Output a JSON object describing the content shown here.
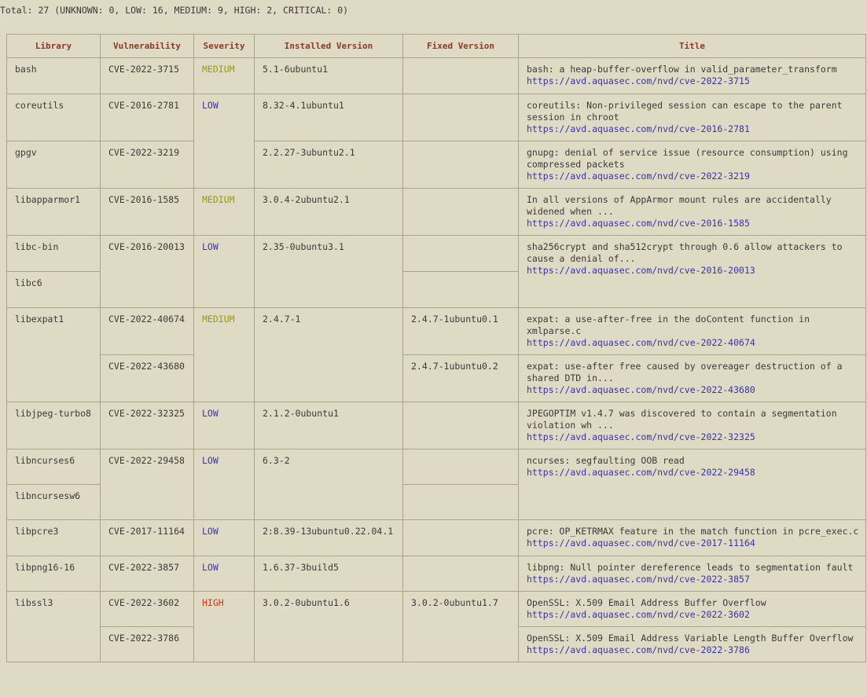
{
  "summary": "Total: 27 (UNKNOWN: 0, LOW: 16, MEDIUM: 9, HIGH: 2, CRITICAL: 0)",
  "columns": [
    "Library",
    "Vulnerability",
    "Severity",
    "Installed Version",
    "Fixed Version",
    "Title"
  ],
  "rows": [
    {
      "library": "bash",
      "vuln": "CVE-2022-3715",
      "severity": "MEDIUM",
      "installed": "5.1-6ubuntu1",
      "fixed": "",
      "title": "bash: a heap-buffer-overflow in valid_parameter_transform",
      "url": "https://avd.aquasec.com/nvd/cve-2022-3715"
    },
    {
      "library": "coreutils",
      "vuln": "CVE-2016-2781",
      "severity": "LOW",
      "installed": "8.32-4.1ubuntu1",
      "fixed": "",
      "title": "coreutils: Non-privileged session can escape to the parent session in chroot",
      "url": "https://avd.aquasec.com/nvd/cve-2016-2781"
    },
    {
      "library": "gpgv",
      "vuln": "CVE-2022-3219",
      "severity": "LOW",
      "installed": "2.2.27-3ubuntu2.1",
      "fixed": "",
      "title": "gnupg: denial of service issue (resource consumption) using compressed packets",
      "url": "https://avd.aquasec.com/nvd/cve-2022-3219"
    },
    {
      "library": "libapparmor1",
      "vuln": "CVE-2016-1585",
      "severity": "MEDIUM",
      "installed": "3.0.4-2ubuntu2.1",
      "fixed": "",
      "title": "In all versions of AppArmor mount rules are accidentally widened when ...",
      "url": "https://avd.aquasec.com/nvd/cve-2016-1585"
    },
    {
      "library": "libc-bin",
      "vuln": "CVE-2016-20013",
      "severity": "LOW",
      "installed": "2.35-0ubuntu3.1",
      "fixed": "",
      "title": "sha256crypt and sha512crypt through 0.6 allow attackers to cause a denial of...",
      "url": "https://avd.aquasec.com/nvd/cve-2016-20013"
    },
    {
      "library": "libc6",
      "vuln": "",
      "severity": "",
      "installed": "",
      "fixed": "",
      "title": "",
      "url": ""
    },
    {
      "library": "libexpat1",
      "vuln": "CVE-2022-40674",
      "severity": "MEDIUM",
      "installed": "2.4.7-1",
      "fixed": "2.4.7-1ubuntu0.1",
      "title": "expat: a use-after-free in the doContent function in xmlparse.c",
      "url": "https://avd.aquasec.com/nvd/cve-2022-40674"
    },
    {
      "library": "",
      "vuln": "CVE-2022-43680",
      "severity": "",
      "installed": "",
      "fixed": "2.4.7-1ubuntu0.2",
      "title": "expat: use-after free caused by overeager destruction of a shared DTD in...",
      "url": "https://avd.aquasec.com/nvd/cve-2022-43680"
    },
    {
      "library": "libjpeg-turbo8",
      "vuln": "CVE-2022-32325",
      "severity": "LOW",
      "installed": "2.1.2-0ubuntu1",
      "fixed": "",
      "title": "JPEGOPTIM v1.4.7 was discovered to contain a segmentation violation wh ...",
      "url": "https://avd.aquasec.com/nvd/cve-2022-32325"
    },
    {
      "library": "libncurses6",
      "vuln": "CVE-2022-29458",
      "severity": "LOW",
      "installed": "6.3-2",
      "fixed": "",
      "title": "ncurses: segfaulting OOB read",
      "url": "https://avd.aquasec.com/nvd/cve-2022-29458"
    },
    {
      "library": "libncursesw6",
      "vuln": "",
      "severity": "",
      "installed": "",
      "fixed": "",
      "title": "",
      "url": ""
    },
    {
      "library": "libpcre3",
      "vuln": "CVE-2017-11164",
      "severity": "LOW",
      "installed": "2:8.39-13ubuntu0.22.04.1",
      "fixed": "",
      "title": "pcre: OP_KETRMAX feature in the match function in pcre_exec.c",
      "url": "https://avd.aquasec.com/nvd/cve-2017-11164"
    },
    {
      "library": "libpng16-16",
      "vuln": "CVE-2022-3857",
      "severity": "LOW",
      "installed": "1.6.37-3build5",
      "fixed": "",
      "title": "libpng: Null pointer dereference leads to segmentation fault",
      "url": "https://avd.aquasec.com/nvd/cve-2022-3857"
    },
    {
      "library": "libssl3",
      "vuln": "CVE-2022-3602",
      "severity": "HIGH",
      "installed": "3.0.2-0ubuntu1.6",
      "fixed": "3.0.2-0ubuntu1.7",
      "title": "OpenSSL: X.509 Email Address Buffer Overflow",
      "url": "https://avd.aquasec.com/nvd/cve-2022-3602"
    },
    {
      "library": "",
      "vuln": "CVE-2022-3786",
      "severity": "",
      "installed": "",
      "fixed": "",
      "title": "OpenSSL: X.509 Email Address Variable Length Buffer Overflow",
      "url": "https://avd.aquasec.com/nvd/cve-2022-3786"
    }
  ]
}
